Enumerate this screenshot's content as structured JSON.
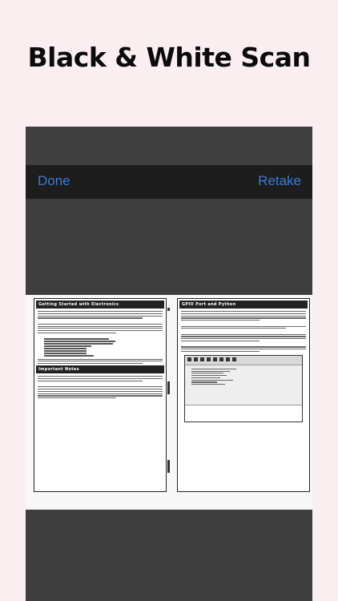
{
  "header": {
    "title": "Black & White Scan"
  },
  "navbar": {
    "done_label": "Done",
    "retake_label": "Retake",
    "accent": "#3a7bd5"
  },
  "scan": {
    "left_page": {
      "heading": "Getting Started with Electronics",
      "section": "Important Notes"
    },
    "right_page": {
      "heading": "GPIO Port and Python"
    }
  }
}
